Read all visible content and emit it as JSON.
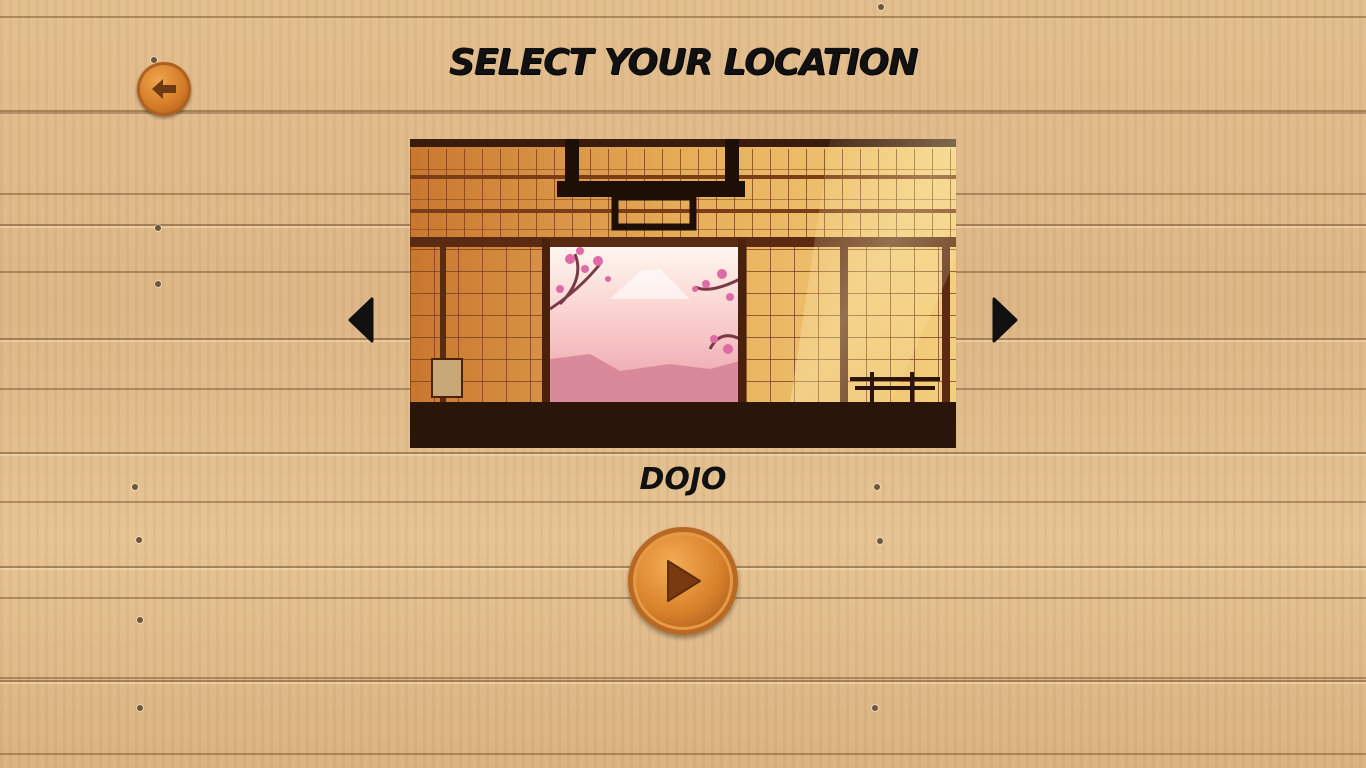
{
  "screen": {
    "title": "SELECT YOUR LOCATION",
    "location_name": "DOJO"
  },
  "icons": {
    "back": "back-arrow-icon",
    "prev": "left-triangle-icon",
    "next": "right-triangle-icon",
    "play": "play-icon"
  },
  "colors": {
    "wood_background": "#e0ba88",
    "button_wood": "#d8822b",
    "text": "#111111"
  }
}
